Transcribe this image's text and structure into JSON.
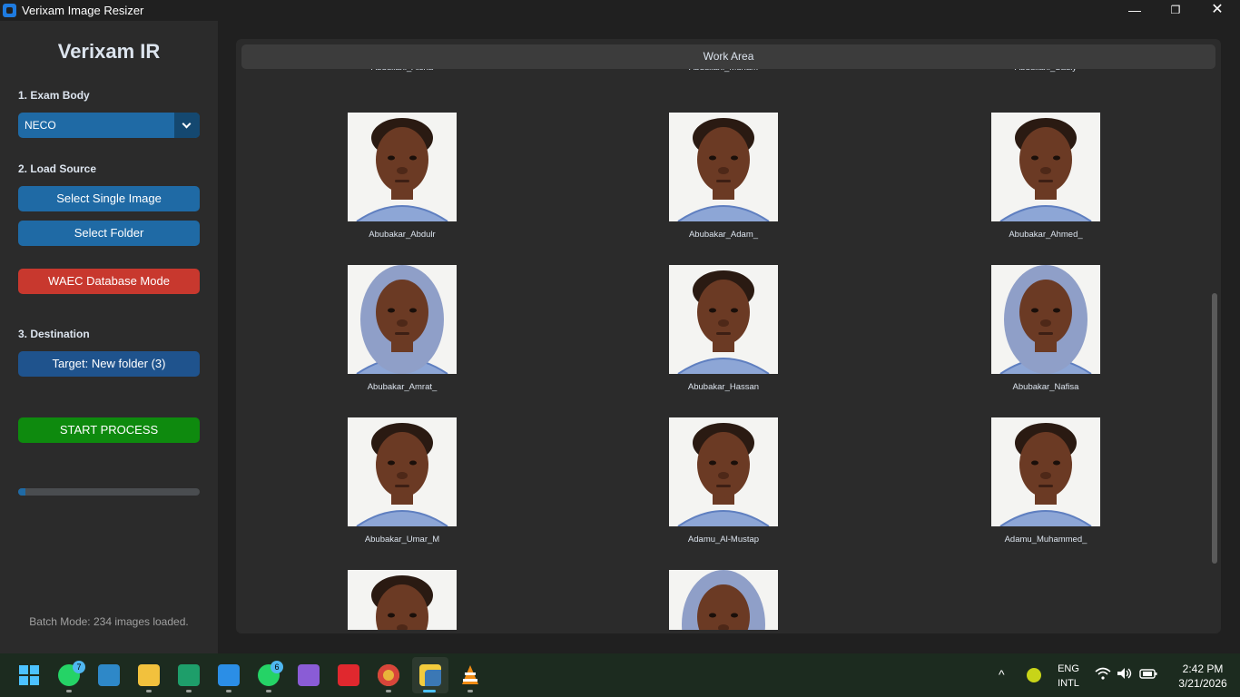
{
  "window": {
    "title": "Verixam Image Resizer",
    "minimize": "—",
    "maximize": "❐",
    "close": "✕"
  },
  "sidebar": {
    "brand": "Verixam IR",
    "exam_body_label": "1. Exam Body",
    "exam_body_value": "NECO",
    "load_source_label": "2. Load Source",
    "select_single": "Select Single Image",
    "select_folder": "Select Folder",
    "waec_mode": "WAEC Database Mode",
    "destination_label": "3. Destination",
    "target": "Target: New folder (3)",
    "start": "START PROCESS",
    "progress": 0.04,
    "status": "Batch Mode: 234 images loaded."
  },
  "work_area": {
    "header": "Work Area",
    "partial_labels": [
      "Abdullahi_Aisha",
      "Abdullahi_Muham",
      "Abdullahi_Sadiy"
    ],
    "items": [
      {
        "name": "Abubakar_Abdulr",
        "scarf": false
      },
      {
        "name": "Abubakar_Adam_",
        "scarf": false
      },
      {
        "name": "Abubakar_Ahmed_",
        "scarf": false
      },
      {
        "name": "Abubakar_Amrat_",
        "scarf": true
      },
      {
        "name": "Abubakar_Hassan",
        "scarf": false
      },
      {
        "name": "Abubakar_Nafisa",
        "scarf": true
      },
      {
        "name": "Abubakar_Umar_M",
        "scarf": false
      },
      {
        "name": "Adamu_Al-Mustap",
        "scarf": false
      },
      {
        "name": "Adamu_Muhammed_",
        "scarf": false
      },
      {
        "name": "",
        "scarf": false
      },
      {
        "name": "",
        "scarf": true
      }
    ]
  },
  "taskbar": {
    "apps": [
      "windows-start-icon",
      "whatsapp-icon",
      "photos-icon",
      "file-explorer-icon",
      "excel-like-icon",
      "vscode-icon",
      "whatsapp-icon-2",
      "visual-studio-icon",
      "wps-icon",
      "chrome-icon",
      "python-icon",
      "vlc-icon"
    ],
    "badges": {
      "whatsapp": "7",
      "whatsapp2": "6"
    },
    "lang_top": "ENG",
    "lang_bottom": "INTL",
    "time": "2:42 PM",
    "date": "3/21/2026"
  }
}
